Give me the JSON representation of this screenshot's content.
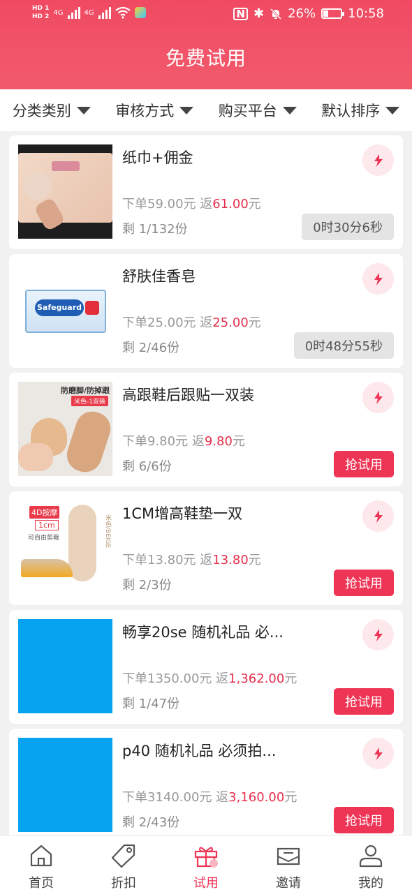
{
  "status_bar": {
    "hd1": "HD 1",
    "hd2": "HD 2",
    "net1": "4G",
    "net2": "4G",
    "battery": "26%",
    "time": "10:58"
  },
  "header": {
    "title": "免费试用"
  },
  "filters": [
    {
      "label": "分类类别"
    },
    {
      "label": "审核方式"
    },
    {
      "label": "购买平台"
    },
    {
      "label": "默认排序"
    }
  ],
  "products": [
    {
      "name": "纸巾+佣金",
      "order_label": "下单",
      "order_price": "59.00元",
      "rebate_label": "返",
      "rebate_value": "61.00",
      "rebate_unit": "元",
      "remain": "剩 1/132份",
      "action": "0时30分6秒",
      "action_type": "timer",
      "thumb": "tissue"
    },
    {
      "name": "舒肤佳香皂",
      "order_label": "下单",
      "order_price": "25.00元",
      "rebate_label": "返",
      "rebate_value": "25.00",
      "rebate_unit": "元",
      "remain": "剩 2/46份",
      "action": "0时48分55秒",
      "action_type": "timer",
      "thumb": "soap"
    },
    {
      "name": "高跟鞋后跟贴一双装",
      "order_label": "下单",
      "order_price": "9.80元",
      "rebate_label": "返",
      "rebate_value": "9.80",
      "rebate_unit": "元",
      "remain": "剩 6/6份",
      "action": "抢试用",
      "action_type": "grab",
      "thumb": "heel"
    },
    {
      "name": "1CM增高鞋垫一双",
      "order_label": "下单",
      "order_price": "13.80元",
      "rebate_label": "返",
      "rebate_value": "13.80",
      "rebate_unit": "元",
      "remain": "剩 2/3份",
      "action": "抢试用",
      "action_type": "grab",
      "thumb": "insole"
    },
    {
      "name": "畅享20se 随机礼品 必...",
      "order_label": "下单",
      "order_price": "1350.00元",
      "rebate_label": "返",
      "rebate_value": "1,362.00",
      "rebate_unit": "元",
      "remain": "剩 1/47份",
      "action": "抢试用",
      "action_type": "grab",
      "thumb": "blue"
    },
    {
      "name": "p40 随机礼品 必须拍...",
      "order_label": "下单",
      "order_price": "3140.00元",
      "rebate_label": "返",
      "rebate_value": "3,160.00",
      "rebate_unit": "元",
      "remain": "剩 2/43份",
      "action": "抢试用",
      "action_type": "grab",
      "thumb": "blue"
    }
  ],
  "thumb_text": {
    "heel_banner": "防磨脚/防掉跟",
    "heel_sub": "米色-1双装",
    "insole_tag": "4D按摩",
    "insole_size": "1cm",
    "insole_note": "可自由剪裁",
    "insole_side": "米色/BEIGE",
    "soap_brand": "Safeguard"
  },
  "bottom_nav": [
    {
      "label": "首页",
      "icon": "home-icon",
      "active": false
    },
    {
      "label": "折扣",
      "icon": "tag-icon",
      "active": false
    },
    {
      "label": "试用",
      "icon": "gift-icon",
      "active": true
    },
    {
      "label": "邀请",
      "icon": "mail-icon",
      "active": false
    },
    {
      "label": "我的",
      "icon": "user-icon",
      "active": false
    }
  ],
  "colors": {
    "accent": "#ef3556",
    "header": "#f04a62",
    "timer_bg": "#e4e4e4"
  }
}
